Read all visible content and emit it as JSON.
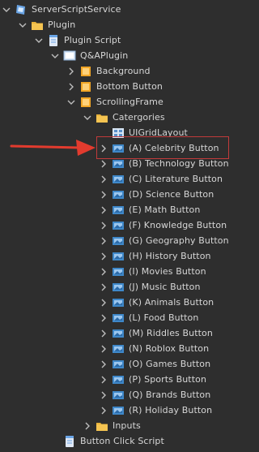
{
  "tree": [
    {
      "depth": 0,
      "expand": "down",
      "icon": "server-script-service-icon",
      "label": "ServerScriptService"
    },
    {
      "depth": 1,
      "expand": "down",
      "icon": "folder-icon",
      "label": "Plugin"
    },
    {
      "depth": 2,
      "expand": "down",
      "icon": "script-icon",
      "label": "Plugin Script"
    },
    {
      "depth": 3,
      "expand": "down",
      "icon": "screen-gui-icon",
      "label": "Q&APlugin"
    },
    {
      "depth": 4,
      "expand": "right",
      "icon": "frame-icon",
      "label": "Background"
    },
    {
      "depth": 4,
      "expand": "right",
      "icon": "frame-icon",
      "label": "Bottom Button"
    },
    {
      "depth": 4,
      "expand": "down",
      "icon": "frame-icon",
      "label": "ScrollingFrame"
    },
    {
      "depth": 5,
      "expand": "down",
      "icon": "folder-icon",
      "label": "Catergories"
    },
    {
      "depth": 6,
      "expand": "none",
      "icon": "grid-layout-icon",
      "label": "UIGridLayout"
    },
    {
      "depth": 6,
      "expand": "right",
      "icon": "image-button-icon",
      "label": "(A) Celebrity Button"
    },
    {
      "depth": 6,
      "expand": "right",
      "icon": "image-button-icon",
      "label": "(B) Technology Button"
    },
    {
      "depth": 6,
      "expand": "right",
      "icon": "image-button-icon",
      "label": "(C) Literature Button"
    },
    {
      "depth": 6,
      "expand": "right",
      "icon": "image-button-icon",
      "label": "(D) Science Button"
    },
    {
      "depth": 6,
      "expand": "right",
      "icon": "image-button-icon",
      "label": "(E) Math Button"
    },
    {
      "depth": 6,
      "expand": "right",
      "icon": "image-button-icon",
      "label": "(F) Knowledge Button"
    },
    {
      "depth": 6,
      "expand": "right",
      "icon": "image-button-icon",
      "label": "(G) Geography  Button"
    },
    {
      "depth": 6,
      "expand": "right",
      "icon": "image-button-icon",
      "label": "(H) History Button"
    },
    {
      "depth": 6,
      "expand": "right",
      "icon": "image-button-icon",
      "label": "(I) Movies Button"
    },
    {
      "depth": 6,
      "expand": "right",
      "icon": "image-button-icon",
      "label": "(J) Music Button"
    },
    {
      "depth": 6,
      "expand": "right",
      "icon": "image-button-icon",
      "label": "(K) Animals Button"
    },
    {
      "depth": 6,
      "expand": "right",
      "icon": "image-button-icon",
      "label": "(L) Food Button"
    },
    {
      "depth": 6,
      "expand": "right",
      "icon": "image-button-icon",
      "label": "(M) Riddles Button"
    },
    {
      "depth": 6,
      "expand": "right",
      "icon": "image-button-icon",
      "label": "(N) Roblox Button"
    },
    {
      "depth": 6,
      "expand": "right",
      "icon": "image-button-icon",
      "label": "(O) Games Button"
    },
    {
      "depth": 6,
      "expand": "right",
      "icon": "image-button-icon",
      "label": "(P) Sports Button"
    },
    {
      "depth": 6,
      "expand": "right",
      "icon": "image-button-icon",
      "label": "(Q) Brands Button"
    },
    {
      "depth": 6,
      "expand": "right",
      "icon": "image-button-icon",
      "label": "(R) Holiday Button"
    },
    {
      "depth": 5,
      "expand": "right",
      "icon": "folder-icon",
      "label": "Inputs"
    },
    {
      "depth": 3,
      "expand": "none",
      "icon": "script-icon",
      "label": "Button Click Script"
    }
  ],
  "highlight": {
    "row_label": "(A) Celebrity Button",
    "border_color": "#c23b3b",
    "arrow_color": "#e23b2e"
  },
  "colors": {
    "background": "#2e2e2e",
    "text": "#d6d6d6",
    "folder": "#e8b23a",
    "frame": "#f2a626",
    "image_button": "#3f88c9"
  }
}
